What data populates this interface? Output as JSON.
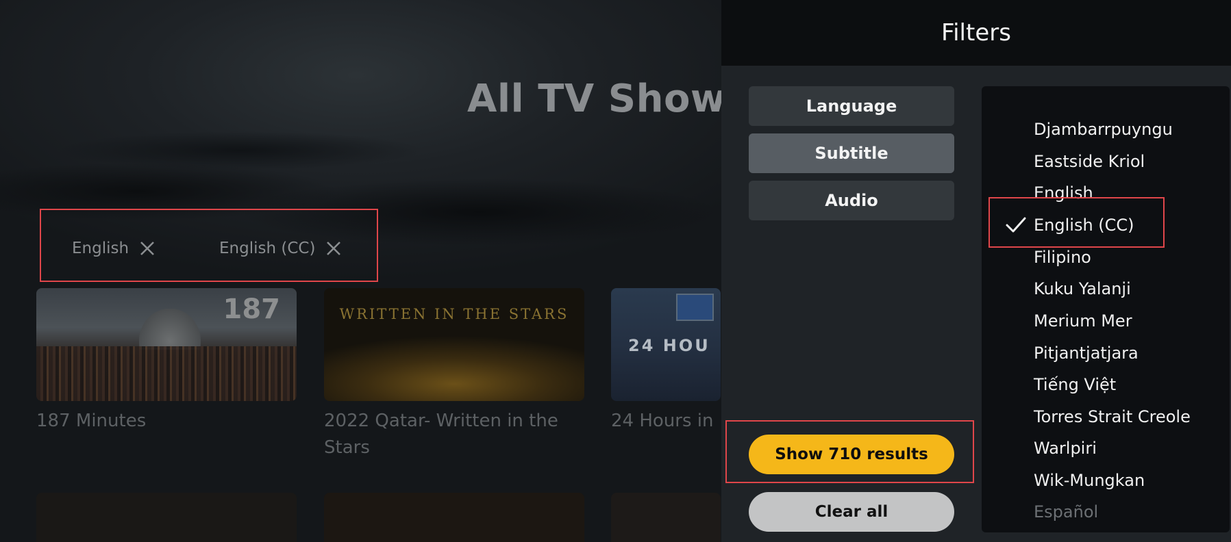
{
  "background": {
    "page_title": "All TV Shows",
    "active_filters": [
      {
        "label": "English",
        "icon": "close-icon"
      },
      {
        "label": "English (CC)",
        "icon": "close-icon"
      }
    ],
    "cards": [
      {
        "title": "187 Minutes",
        "thumb_text": "187"
      },
      {
        "title": "2022 Qatar- Written in the Stars",
        "thumb_text": "WRITTEN IN THE STARS"
      },
      {
        "title": "24 Hours in",
        "thumb_text": "24 HOU"
      }
    ]
  },
  "filters": {
    "title": "Filters",
    "tabs": [
      {
        "label": "Language",
        "active": false
      },
      {
        "label": "Subtitle",
        "active": true
      },
      {
        "label": "Audio",
        "active": false
      }
    ],
    "show_results_label": "Show 710 results",
    "clear_all_label": "Clear all",
    "languages": [
      {
        "name": "Djambarrpuyngu",
        "selected": false
      },
      {
        "name": "Eastside Kriol",
        "selected": false
      },
      {
        "name": "English",
        "selected": false
      },
      {
        "name": "English (CC)",
        "selected": true
      },
      {
        "name": "Filipino",
        "selected": false
      },
      {
        "name": "Kuku Yalanji",
        "selected": false
      },
      {
        "name": "Merium Mer",
        "selected": false
      },
      {
        "name": "Pitjantjatjara",
        "selected": false
      },
      {
        "name": "Tiếng Việt",
        "selected": false
      },
      {
        "name": "Torres Strait Creole",
        "selected": false
      },
      {
        "name": "Warlpiri",
        "selected": false
      },
      {
        "name": "Wik-Mungkan",
        "selected": false
      },
      {
        "name": "Español",
        "selected": false
      }
    ]
  },
  "colors": {
    "accent": "#f5b719",
    "highlight_border": "#e0464a",
    "panel_bg": "#1f2327",
    "list_bg": "#0d0f12"
  }
}
